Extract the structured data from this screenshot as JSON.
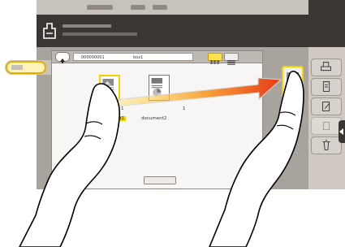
{
  "header": {
    "title": "",
    "subtitle": ""
  },
  "breadcrumb": {
    "number": "000000001",
    "name": "box1"
  },
  "documents": [
    {
      "name": "document1",
      "count": "1",
      "selected": true
    },
    {
      "name": "document2",
      "count": "1",
      "selected": false
    }
  ],
  "footer_button": "",
  "colors": {
    "selection": "#f5d100",
    "arrow_start": "#ffe14d",
    "arrow_end": "#e83a17"
  },
  "icons": [
    "print-icon",
    "move-icon",
    "edit-icon",
    "delete-icon",
    "swipe-arrow-icon",
    "hand-pointer-icon"
  ]
}
